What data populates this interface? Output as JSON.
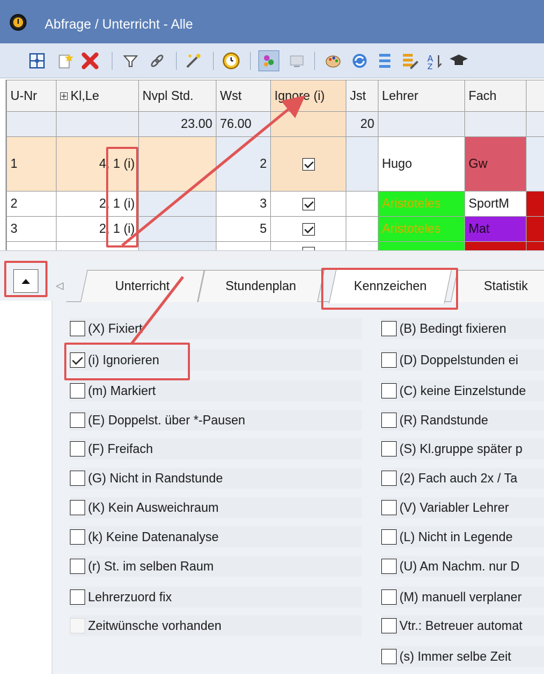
{
  "window": {
    "title": "Abfrage / Unterricht - Alle"
  },
  "toolbar": {
    "buttons": [
      "grid-icon",
      "new-icon",
      "delete-icon",
      "filter-icon",
      "link-icon",
      "wand-icon",
      "clock-icon",
      "people-icon",
      "screen-icon",
      "palette-icon",
      "sync-icon",
      "list-icon",
      "list-edit-icon",
      "sort-icon",
      "graduation-icon"
    ]
  },
  "grid": {
    "columns": [
      "U-Nr",
      "Kl,Le",
      "Nvpl Std.",
      "Wst",
      "Ignore (i)",
      "Jst",
      "Lehrer",
      "Fach"
    ],
    "sums": {
      "nvpl": "23.00",
      "wst": "76.00",
      "jst": "20"
    },
    "rows": [
      {
        "unr": "1",
        "klle": "4, 1",
        "flag": "(i)",
        "wst": "2",
        "lehrer": "Hugo",
        "fach": "Gw"
      },
      {
        "unr": "2",
        "klle": "2, 1",
        "flag": "(i)",
        "wst": "3",
        "lehrer": "Aristoteles",
        "fach": "SportM"
      },
      {
        "unr": "3",
        "klle": "2, 1",
        "flag": "(i)",
        "wst": "5",
        "lehrer": "Aristoteles",
        "fach": "Mat"
      }
    ]
  },
  "tabs": [
    "Unterricht",
    "Stundenplan",
    "Kennzeichen",
    "Statistik"
  ],
  "options_left": [
    {
      "label": "(X) Fixiert",
      "checked": false
    },
    {
      "label": "(i) Ignorieren",
      "checked": true
    },
    {
      "label": "(m) Markiert",
      "checked": false
    },
    {
      "label": "(E) Doppelst. über *-Pausen",
      "checked": false
    },
    {
      "label": "(F) Freifach",
      "checked": false
    },
    {
      "label": "(G) Nicht in Randstunde",
      "checked": false
    },
    {
      "label": "(K) Kein Ausweichraum",
      "checked": false
    },
    {
      "label": "(k) Keine Datenanalyse",
      "checked": false
    },
    {
      "label": "(r) St. im selben Raum",
      "checked": false
    },
    {
      "label": "Lehrerzuord fix",
      "checked": false
    },
    {
      "label": "Zeitwünsche vorhanden",
      "checked": false
    }
  ],
  "options_right": [
    {
      "label": "(B) Bedingt fixieren",
      "checked": false
    },
    {
      "label": "(D) Doppelstunden ei",
      "checked": false
    },
    {
      "label": "(C) keine Einzelstunde",
      "checked": false
    },
    {
      "label": "(R) Randstunde",
      "checked": false
    },
    {
      "label": "(S) Kl.gruppe später p",
      "checked": false
    },
    {
      "label": "(2) Fach auch 2x / Ta",
      "checked": false
    },
    {
      "label": "(V) Variabler Lehrer",
      "checked": false
    },
    {
      "label": "(L) Nicht in Legende",
      "checked": false
    },
    {
      "label": "(U) Am Nachm. nur D",
      "checked": false
    },
    {
      "label": "(M) manuell verplaner",
      "checked": false
    },
    {
      "label": "Vtr.: Betreuer automat",
      "checked": false
    },
    {
      "label": "(s) Immer selbe Zeit",
      "checked": false
    }
  ],
  "colors": {
    "titlebar": "#5b7fb6",
    "callout": "#e05555",
    "gw": "#d9596a",
    "mat": "#9a1ee0",
    "aristoteles": "#22f022"
  }
}
